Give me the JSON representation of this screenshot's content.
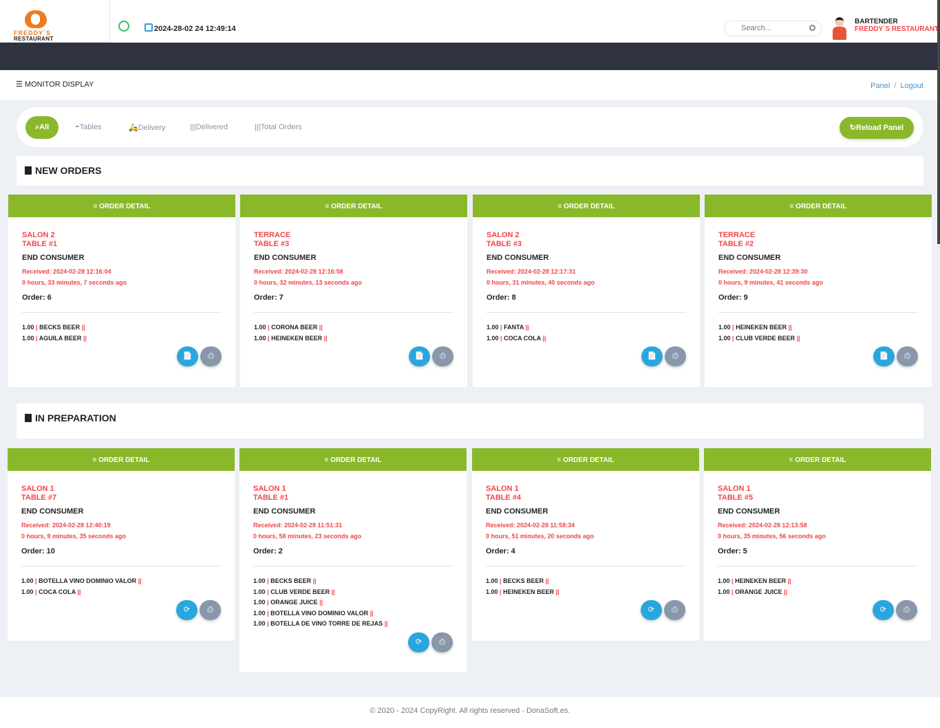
{
  "brand": {
    "name": "FREDDY´S",
    "sub": "RESTAURANT"
  },
  "header": {
    "datetime": "2024-28-02 24 12:49:14",
    "search_placeholder": "Search...",
    "user_role": "BARTENDER",
    "user_restaurant": "FREDDY´S RESTAURANT"
  },
  "breadcrumb": {
    "title": "MONITOR DISPLAY",
    "panel": "Panel",
    "sep": "/",
    "logout": "Logout"
  },
  "filters": {
    "all": "All",
    "tables": "Tables",
    "delivery": "Delivery",
    "delivered": "Delivered",
    "total": "Total Orders",
    "reload": "Reload Panel"
  },
  "colors": {
    "accent": "#8ab82b",
    "alert": "#f0444a",
    "action": "#2aa6df",
    "muted": "#8897aa",
    "dark": "#2f3240"
  },
  "card_header": "ORDER DETAIL",
  "new_orders": {
    "title": "NEW ORDERS",
    "orders": [
      {
        "area": "SALON 2",
        "table": "TABLE #1",
        "customer": "END CONSUMER",
        "received": "Received: 2024-02-28 12:16:04",
        "ago": "0 hours, 33 minutes, 7 seconds ago",
        "order": "Order: 6",
        "items": [
          {
            "qty": "1.00",
            "name": "BECKS BEER"
          },
          {
            "qty": "1.00",
            "name": "AGUILA BEER"
          }
        ]
      },
      {
        "area": "TERRACE",
        "table": "TABLE #3",
        "customer": "END CONSUMER",
        "received": "Received: 2024-02-28 12:16:58",
        "ago": "0 hours, 32 minutes, 13 seconds ago",
        "order": "Order: 7",
        "items": [
          {
            "qty": "1.00",
            "name": "CORONA BEER"
          },
          {
            "qty": "1.00",
            "name": "HEINEKEN BEER"
          }
        ]
      },
      {
        "area": "SALON 2",
        "table": "TABLE #3",
        "customer": "END CONSUMER",
        "received": "Received: 2024-02-28 12:17:31",
        "ago": "0 hours, 31 minutes, 40 seconds ago",
        "order": "Order: 8",
        "items": [
          {
            "qty": "1.00",
            "name": "FANTA"
          },
          {
            "qty": "1.00",
            "name": "COCA COLA"
          }
        ]
      },
      {
        "area": "TERRACE",
        "table": "TABLE #2",
        "customer": "END CONSUMER",
        "received": "Received: 2024-02-28 12:39:30",
        "ago": "0 hours, 9 minutes, 41 seconds ago",
        "order": "Order: 9",
        "items": [
          {
            "qty": "1.00",
            "name": "HEINEKEN BEER"
          },
          {
            "qty": "1.00",
            "name": "CLUB VERDE BEER"
          }
        ]
      }
    ]
  },
  "in_preparation": {
    "title": "IN PREPARATION",
    "orders": [
      {
        "area": "SALON 1",
        "table": "TABLE #7",
        "customer": "END CONSUMER",
        "received": "Received: 2024-02-28 12:40:19",
        "ago": "0 hours, 9 minutes, 35 seconds ago",
        "order": "Order: 10",
        "items": [
          {
            "qty": "1.00",
            "name": "BOTELLA VINO DOMINIO VALOR"
          },
          {
            "qty": "1.00",
            "name": "COCA COLA"
          }
        ]
      },
      {
        "area": "SALON 1",
        "table": "TABLE #1",
        "customer": "END CONSUMER",
        "received": "Received: 2024-02-28 11:51:31",
        "ago": "0 hours, 58 minutes, 23 seconds ago",
        "order": "Order: 2",
        "items": [
          {
            "qty": "1.00",
            "name": "BECKS BEER"
          },
          {
            "qty": "1.00",
            "name": "CLUB VERDE BEER"
          },
          {
            "qty": "1.00",
            "name": "ORANGE JUICE"
          },
          {
            "qty": "1.00",
            "name": "BOTELLA VINO DOMINIO VALOR"
          },
          {
            "qty": "1.00",
            "name": "BOTELLA DE VINO TORRE DE REJAS"
          }
        ]
      },
      {
        "area": "SALON 1",
        "table": "TABLE #4",
        "customer": "END CONSUMER",
        "received": "Received: 2024-02-28 11:58:34",
        "ago": "0 hours, 51 minutes, 20 seconds ago",
        "order": "Order: 4",
        "items": [
          {
            "qty": "1.00",
            "name": "BECKS BEER"
          },
          {
            "qty": "1.00",
            "name": "HEINEKEN BEER"
          }
        ]
      },
      {
        "area": "SALON 1",
        "table": "TABLE #5",
        "customer": "END CONSUMER",
        "received": "Received: 2024-02-28 12:13:58",
        "ago": "0 hours, 35 minutes, 56 seconds ago",
        "order": "Order: 5",
        "items": [
          {
            "qty": "1.00",
            "name": "HEINEKEN BEER"
          },
          {
            "qty": "1.00",
            "name": "ORANGE JUICE"
          }
        ]
      }
    ]
  },
  "footer": "© 2020 - 2024 CopyRight. All rights reserved - DonaSoft.es."
}
